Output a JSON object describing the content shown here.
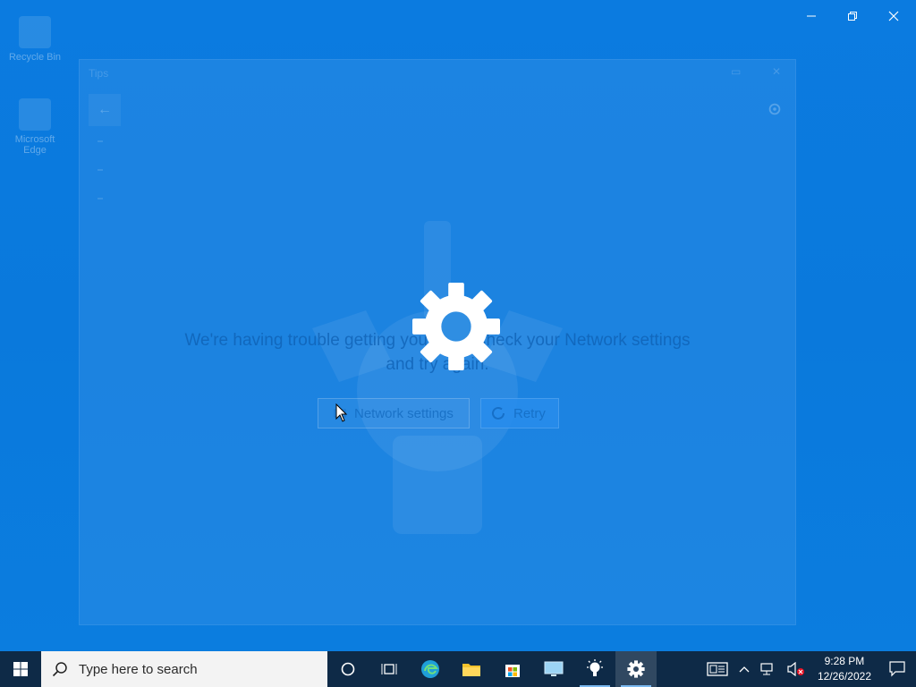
{
  "desktop": {
    "icons": [
      {
        "label": "Recycle Bin"
      },
      {
        "label": "Microsoft Edge"
      }
    ]
  },
  "app": {
    "title": "Tips",
    "message_line1": "We're having trouble getting your tips. Check your Network settings",
    "message_line2": "and try again.",
    "network_button": "Network settings",
    "retry_button": "Retry"
  },
  "taskbar": {
    "search_placeholder": "Type here to search",
    "apps": [
      {
        "icon": "cortana-icon"
      },
      {
        "icon": "task-view-icon"
      },
      {
        "icon": "edge-icon"
      },
      {
        "icon": "file-explorer-icon"
      },
      {
        "icon": "store-icon"
      },
      {
        "icon": "remote-desktop-icon"
      },
      {
        "icon": "tips-icon",
        "running": true
      },
      {
        "icon": "settings-icon",
        "active": true
      }
    ],
    "time": "9:28 PM",
    "date": "12/26/2022"
  },
  "colors": {
    "desktop": "#0b7be0",
    "taskbar": "#0e2a47",
    "accent": "#0078d7"
  }
}
